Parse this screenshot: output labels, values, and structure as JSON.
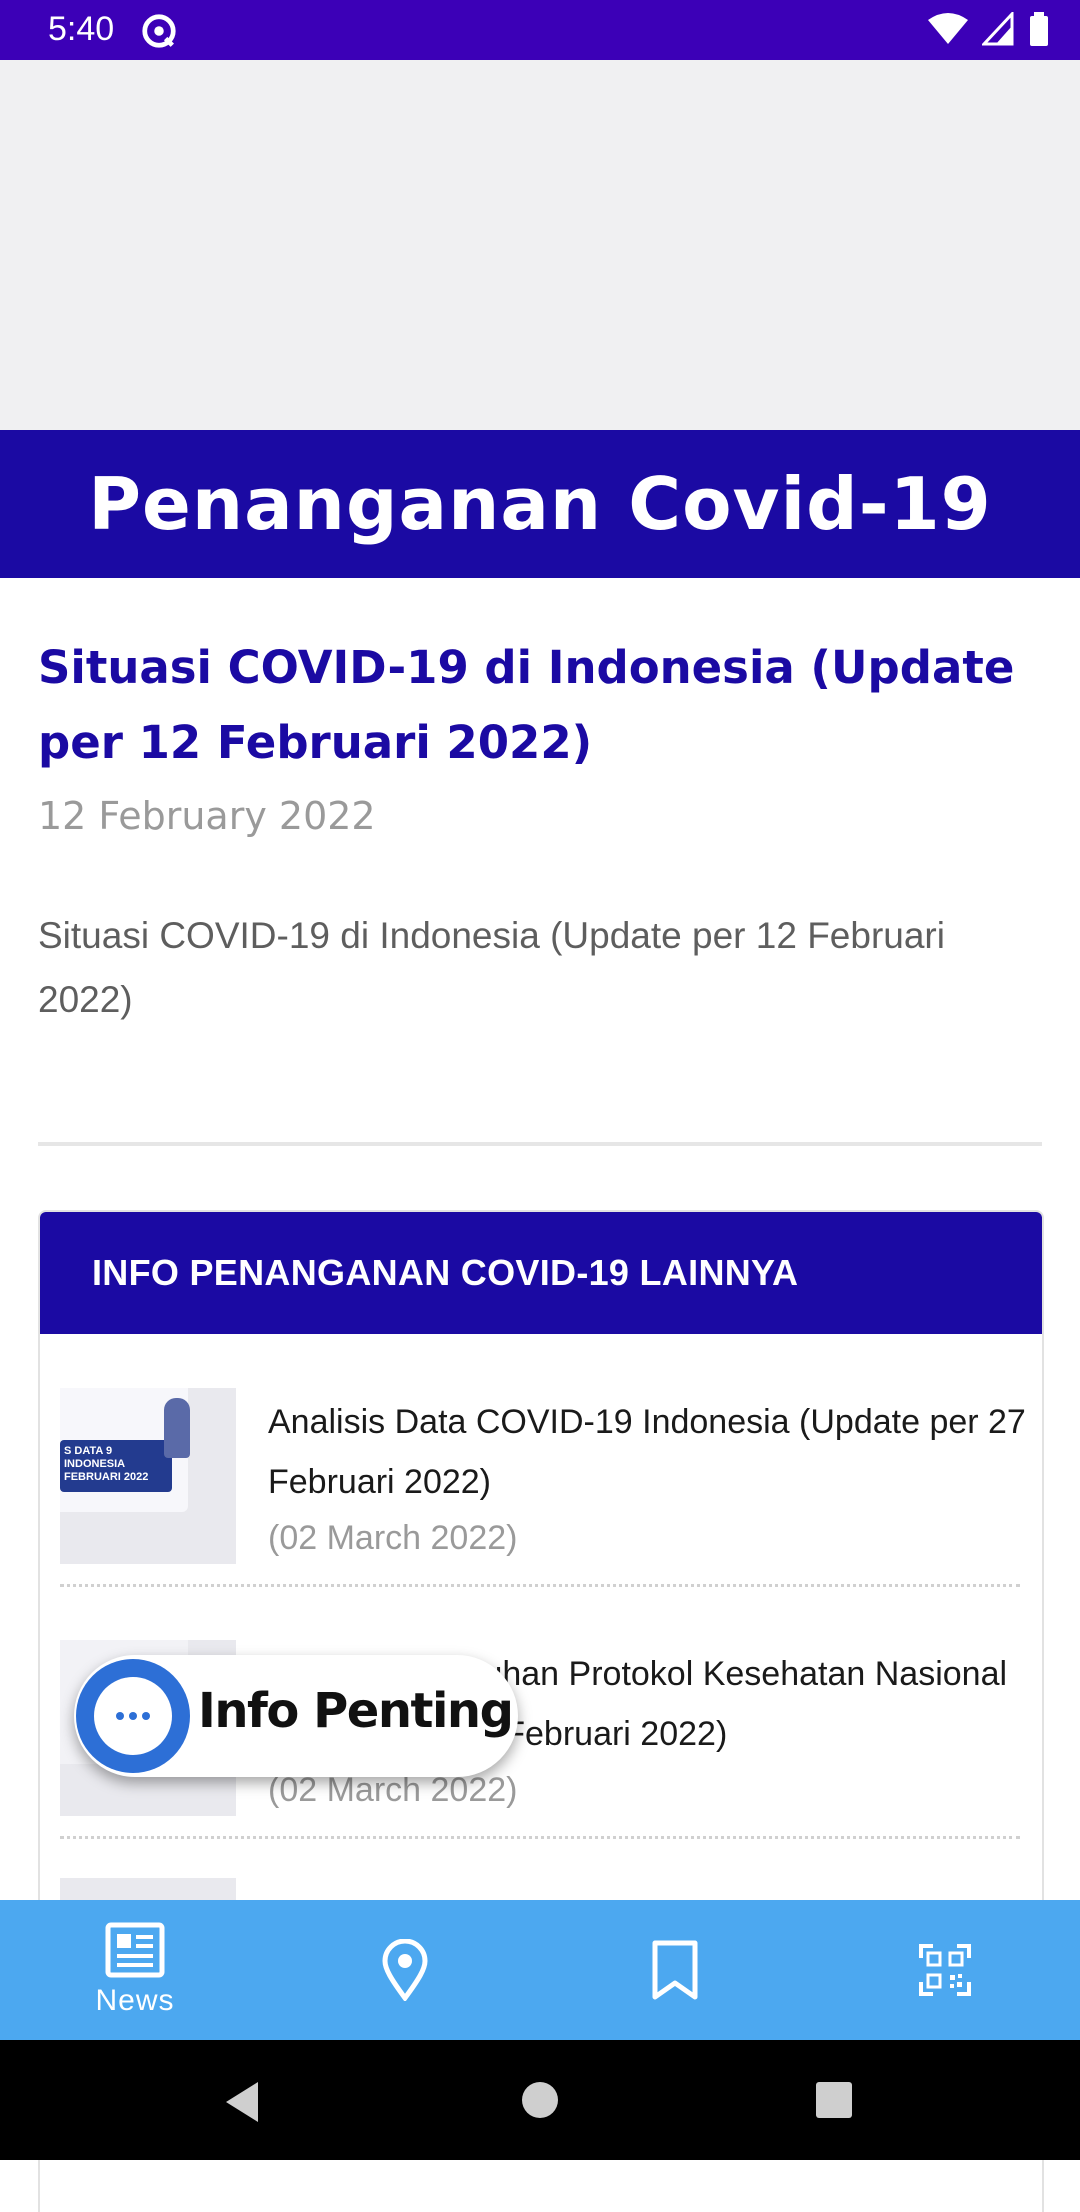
{
  "status": {
    "time": "5:40"
  },
  "hero": {
    "title": "Penanganan Covid-19"
  },
  "article": {
    "title": "Situasi COVID-19 di Indonesia (Update per 12 Februari 2022)",
    "date": "12 February 2022",
    "summary": "Situasi COVID-19 di Indonesia (Update per 12 Februari 2022)"
  },
  "card": {
    "header": "INFO PENANGANAN COVID-19 LAINNYA",
    "items": [
      {
        "title": "Analisis Data COVID-19 Indonesia (Update per 27 Februari 2022)",
        "date": "(02 March 2022)",
        "thumb_text": "S DATA 9 INDONESIA FEBRUARI 2022"
      },
      {
        "title": "Analisis Kepatuhan Protokol Kesehatan Nasional (Update per 27 Februari 2022)",
        "title_visible": "atuhan Protokol Kesehatan\nl (Update per 27 Februari 2022)",
        "date": "(02 March 2022)"
      }
    ]
  },
  "fab": {
    "label": "Info Penting"
  },
  "bottom_nav": {
    "items": [
      {
        "label": "News",
        "icon": "newspaper-icon",
        "active": true
      },
      {
        "label": "",
        "icon": "location-pin-icon"
      },
      {
        "label": "",
        "icon": "bookmark-icon"
      },
      {
        "label": "",
        "icon": "qr-code-icon"
      }
    ]
  },
  "colors": {
    "status_bar": "#3c00b7",
    "primary": "#1b0aa3",
    "nav": "#4ca8f0",
    "fab_blue": "#2d6fd6"
  }
}
